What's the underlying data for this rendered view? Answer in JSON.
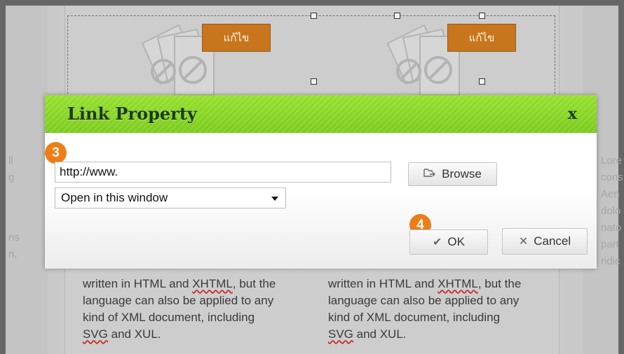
{
  "edit_buttons": [
    "แก้ไข",
    "แก้ไข"
  ],
  "left_side_text": [
    "ll",
    "g",
    "",
    "",
    "",
    "ns",
    "n,"
  ],
  "right_side_text": [
    "Lore",
    "cons",
    "Aen",
    "dolo",
    "nato",
    "part",
    "ridic"
  ],
  "body_text_left": {
    "line1_a": "written in HTML and ",
    "line1_b": "XHTML",
    "line1_c": ", but the",
    "line2": "language can also be applied to any",
    "line3": "kind of XML document, including",
    "line4_a": "SVG",
    "line4_b": " and XUL."
  },
  "body_text_right": {
    "line1_a": "written in HTML and ",
    "line1_b": "XHTML",
    "line1_c": ", but the",
    "line2": "language can also be applied to any",
    "line3": "kind of XML document, including",
    "line4_a": "SVG",
    "line4_b": " and XUL."
  },
  "dialog": {
    "title": "Link Property",
    "close_label": "x",
    "url_value": "http://www.",
    "target_selected": "Open in this window",
    "browse_label": "Browse",
    "ok_label": "OK",
    "cancel_label": "Cancel",
    "badge_url_step": "3",
    "badge_ok_step": "4",
    "icons": {
      "browse": "folder-arrow-icon",
      "ok": "checkmark-icon",
      "cancel": "x-icon"
    }
  },
  "colors": {
    "header_green": "#86d324",
    "edit_button_orange": "#c8761e",
    "badge_orange": "#ee7d16"
  }
}
